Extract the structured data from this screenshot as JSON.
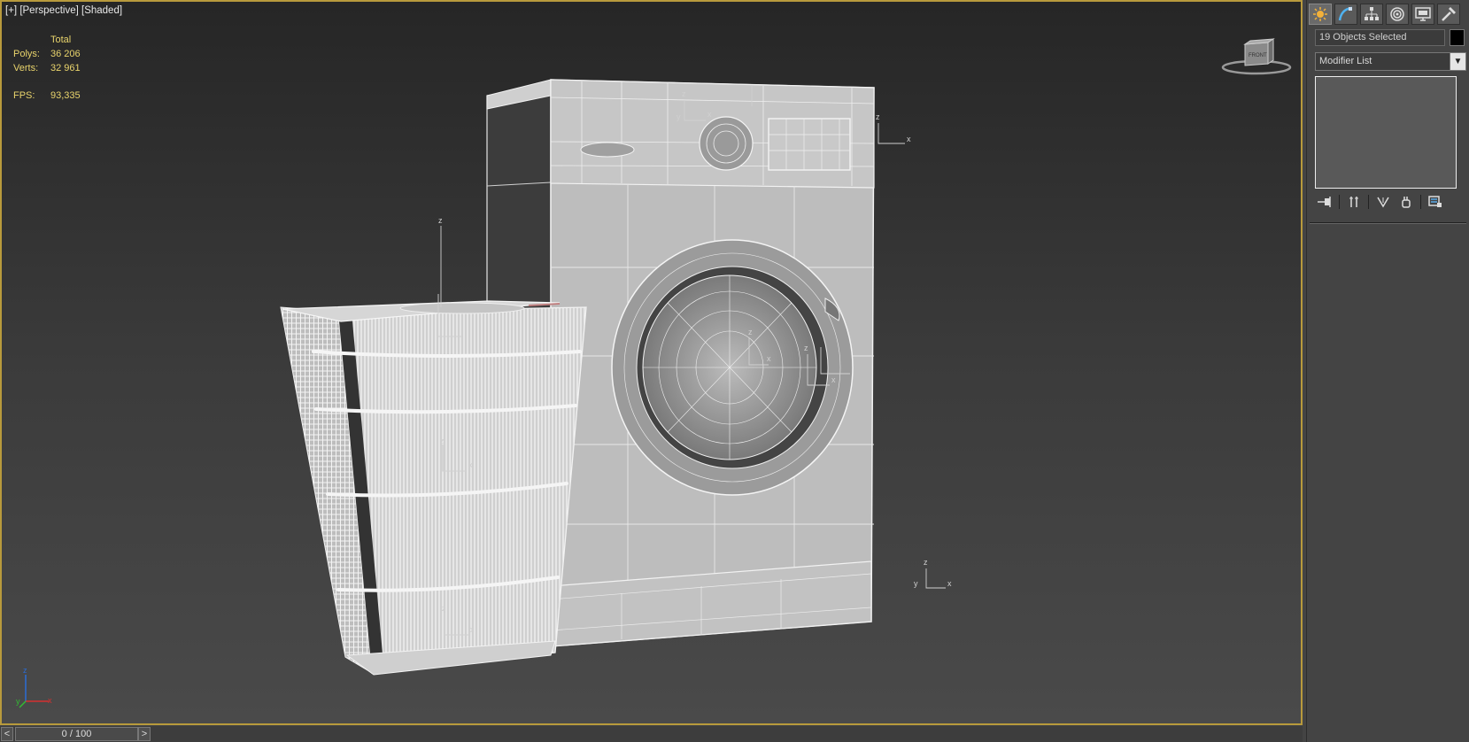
{
  "viewport": {
    "label_plus": "[+]",
    "label_view": "[Perspective]",
    "label_shading": "[Shaded]",
    "border_color": "#b89a3c"
  },
  "stats": {
    "header": "Total",
    "polys_label": "Polys:",
    "polys_value": "36 206",
    "verts_label": "Verts:",
    "verts_value": "32 961",
    "fps_label": "FPS:",
    "fps_value": "93,335",
    "color": "#e9d46c"
  },
  "viewcube": {
    "face_label": "FRONT"
  },
  "command_panel": {
    "tabs": [
      "create-icon",
      "modify-icon",
      "hierarchy-icon",
      "motion-icon",
      "display-icon",
      "utilities-icon"
    ],
    "selection_text": "19 Objects Selected",
    "modifier_list_label": "Modifier List",
    "stack_tools": [
      "pin-stack-icon",
      "show-end-result-icon",
      "make-unique-icon",
      "remove-modifier-icon",
      "configure-sets-icon"
    ]
  },
  "timeline": {
    "frame_display": "0 / 100",
    "prev_label": "<",
    "next_label": ">"
  }
}
